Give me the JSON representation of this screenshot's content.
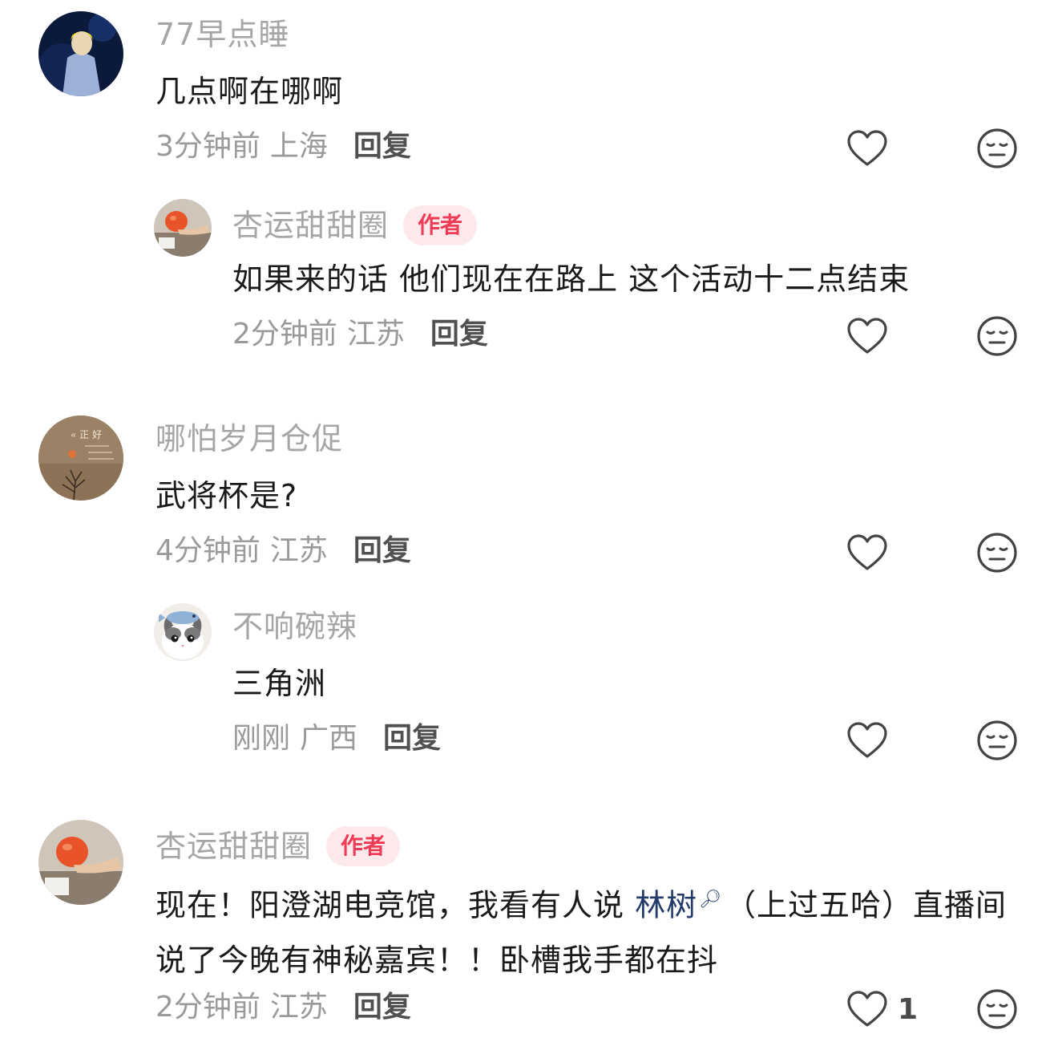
{
  "comments": [
    {
      "username": "77早点睡",
      "author_badge": "",
      "text": "几点啊在哪啊",
      "time": "3分钟前",
      "region": "上海",
      "reply_label": "回复",
      "like_count": "",
      "avatar_icon": "concert-person-avatar"
    },
    {
      "username": "杏运甜甜圈",
      "author_badge": "作者",
      "text": "如果来的话 他们现在在路上 这个活动十二点结束",
      "time": "2分钟前",
      "region": "江苏",
      "reply_label": "回复",
      "like_count": "",
      "avatar_icon": "orange-fruit-avatar"
    },
    {
      "username": "哪怕岁月仓促",
      "author_badge": "",
      "text": "武将杯是?",
      "time": "4分钟前",
      "region": "江苏",
      "reply_label": "回复",
      "like_count": "",
      "avatar_icon": "sunset-tree-avatar"
    },
    {
      "username": "不响碗辣",
      "author_badge": "",
      "text": "三角洲",
      "time": "刚刚",
      "region": "广西",
      "reply_label": "回复",
      "like_count": "",
      "avatar_icon": "cat-with-fish-hat-avatar"
    },
    {
      "username": "杏运甜甜圈",
      "author_badge": "作者",
      "text_part1": "现在！阳澄湖电竞馆，我看有人说 ",
      "mention": "林树",
      "text_part2": "（上过五哈）直播间说了今晚有神秘嘉宾！！卧槽我手都在抖",
      "time": "2分钟前",
      "region": "江苏",
      "reply_label": "回复",
      "like_count": "1",
      "avatar_icon": "orange-fruit-avatar"
    }
  ],
  "colors": {
    "username": "#a6a6a6",
    "badge_text": "#ef3b55",
    "badge_bg": "#fde8ec",
    "mention": "#233b6b"
  }
}
